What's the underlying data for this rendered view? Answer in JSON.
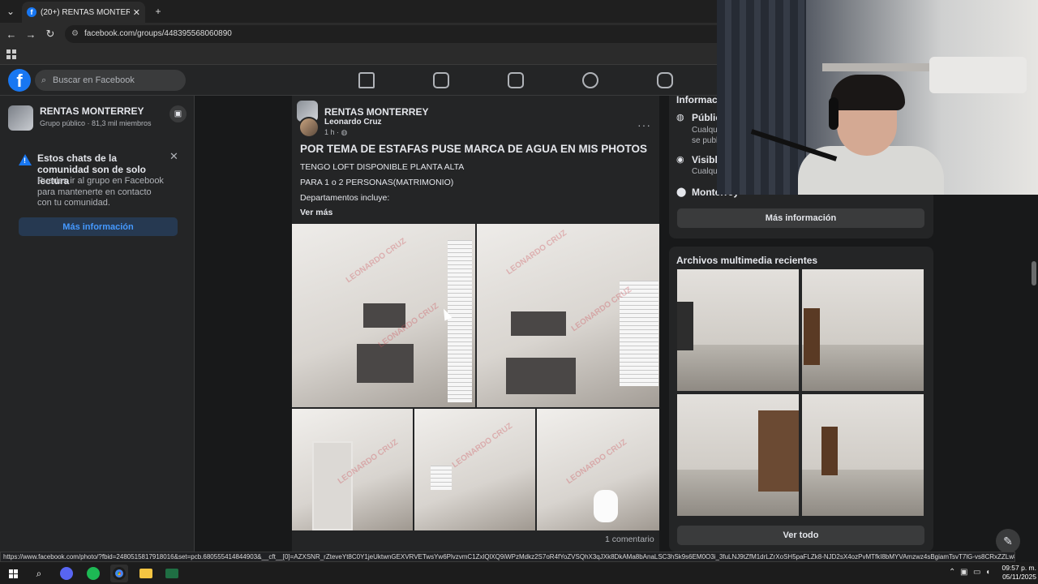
{
  "browser": {
    "tab_title": "(20+) RENTAS MONTERREY | Fa",
    "tab_close": "✕",
    "new_tab": "+",
    "url": "facebook.com/groups/448395568060890",
    "status_url": "https://www.facebook.com/photo/?fbid=2480515817918016&set=pcb.680555414844903&__cft__[0]=AZXSNR_rZteveYt8C0Y1jeUktwnGEXVRVETwsYw6PlvzvmC1ZxlQlXQ9iWPzMdkz2S7oR4fYoZVSQhX3qJXk8DkAMa8bAnaLSC3hSk9s6EM0O3i_3fuLNJ9tZfM1drLZrXoSH5paFLZk8-NJD2sX4ozPvMTfkI8bMYVAmzwz4sBgiamTsvT7lG-vs8CRxZZLw8qEt8VXjA..."
  },
  "header": {
    "search_placeholder": "Buscar en Facebook"
  },
  "sidebar": {
    "group_name": "RENTAS MONTERREY",
    "group_meta": "Grupo público · 81,3 mil miembros",
    "notice_title": "Estos chats de la comunidad son de solo lectura",
    "notice_body": "Puedes ir al grupo en Facebook para mantenerte en contacto con tu comunidad.",
    "more_info_label": "Más información"
  },
  "post": {
    "group": "RENTAS MONTERREY",
    "author": "Leonardo Cruz",
    "time": "1 h · ",
    "title": "POR TEMA DE ESTAFAS PUSE MARCA DE AGUA EN MIS PHOTOS",
    "lines": [
      "TENGO LOFT DISPONIBLE PLANTA ALTA",
      "PARA 1 o 2 PERSONAS(MATRIMONIO)",
      "Departamentos incluye:"
    ],
    "see_more": "Ver más",
    "watermark": "LEONARDO CRUZ",
    "comments": "1 comentario",
    "menu": "···"
  },
  "info": {
    "title": "Informació",
    "public_head": "Públic",
    "public_sub": "Cualqu\nse publ",
    "visible_head": "Visible",
    "visible_sub": "Cualqu",
    "location": "Monterrey",
    "more_info_label": "Más información"
  },
  "media": {
    "title": "Archivos multimedia recientes",
    "see_all": "Ver todo"
  },
  "taskbar": {
    "time": "09:57 p. m.",
    "date": "05/11/2025"
  },
  "colors": {
    "fb_blue": "#1877f2",
    "bg": "#18191a",
    "card": "#242526"
  }
}
